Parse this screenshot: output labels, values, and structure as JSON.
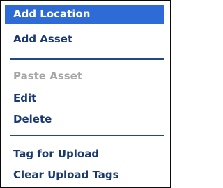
{
  "context_menu": {
    "items": [
      {
        "label": "Add Location"
      },
      {
        "label": "Add Asset"
      },
      {
        "label": "Paste Asset"
      },
      {
        "label": "Edit"
      },
      {
        "label": "Delete"
      },
      {
        "label": "Tag for Upload"
      },
      {
        "label": "Clear Upload Tags"
      }
    ]
  },
  "colors": {
    "highlight": "#2f6bd7",
    "text": "#1b3a73",
    "disabled": "#a6a6a6",
    "separator": "#1e4a86"
  }
}
